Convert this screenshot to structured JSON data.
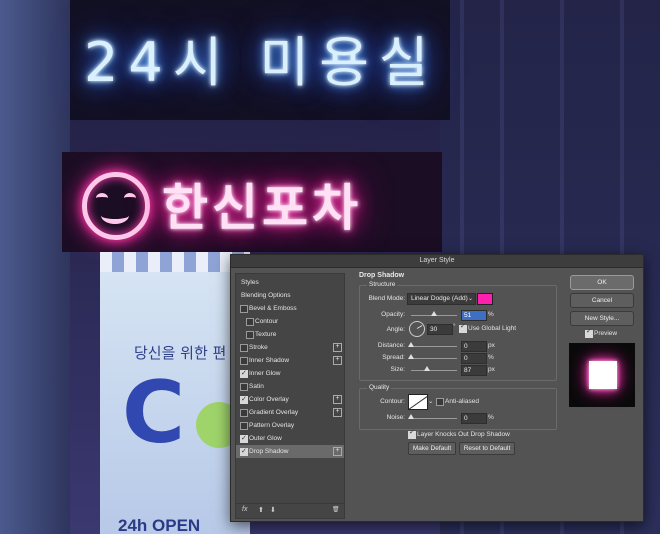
{
  "background": {
    "neon_blue_text": "24시 미용실",
    "neon_pink_text": "한신포차",
    "banner_text": "당신을 위한 편",
    "banner_letter": "C",
    "banner_hours": "24h OPEN",
    "colors": {
      "neon_blue": "#3a7bff",
      "neon_pink": "#ff1f9c"
    }
  },
  "dialog": {
    "title": "Layer Style",
    "styles_list": {
      "header": "Styles",
      "blending_options": "Blending Options",
      "items": [
        {
          "label": "Bevel & Emboss",
          "checked": false,
          "indent": false,
          "plus": false
        },
        {
          "label": "Contour",
          "checked": false,
          "indent": true,
          "plus": false
        },
        {
          "label": "Texture",
          "checked": false,
          "indent": true,
          "plus": false
        },
        {
          "label": "Stroke",
          "checked": false,
          "indent": false,
          "plus": true
        },
        {
          "label": "Inner Shadow",
          "checked": false,
          "indent": false,
          "plus": true
        },
        {
          "label": "Inner Glow",
          "checked": true,
          "indent": false,
          "plus": false
        },
        {
          "label": "Satin",
          "checked": false,
          "indent": false,
          "plus": false
        },
        {
          "label": "Color Overlay",
          "checked": true,
          "indent": false,
          "plus": true
        },
        {
          "label": "Gradient Overlay",
          "checked": false,
          "indent": false,
          "plus": true
        },
        {
          "label": "Pattern Overlay",
          "checked": false,
          "indent": false,
          "plus": false
        },
        {
          "label": "Outer Glow",
          "checked": true,
          "indent": false,
          "plus": false
        },
        {
          "label": "Drop Shadow",
          "checked": true,
          "indent": false,
          "plus": true,
          "selected": true
        }
      ],
      "footer": {
        "fx": "fx",
        "up": "⬆",
        "down": "⬇",
        "trash": "🗑"
      }
    },
    "drop_shadow": {
      "section_title": "Drop Shadow",
      "structure_title": "Structure",
      "blend_mode_label": "Blend Mode:",
      "blend_mode_value": "Linear Dodge (Add)",
      "blend_color": "#ff1fae",
      "opacity_label": "Opacity:",
      "opacity_value": "51",
      "opacity_unit": "%",
      "angle_label": "Angle:",
      "angle_value": "30",
      "angle_unit": "°",
      "use_global_light_label": "Use Global Light",
      "use_global_light": true,
      "distance_label": "Distance:",
      "distance_value": "0",
      "distance_unit": "px",
      "spread_label": "Spread:",
      "spread_value": "0",
      "spread_unit": "%",
      "size_label": "Size:",
      "size_value": "87",
      "size_unit": "px",
      "quality_title": "Quality",
      "contour_label": "Contour:",
      "anti_aliased_label": "Anti-aliased",
      "anti_aliased": false,
      "noise_label": "Noise:",
      "noise_value": "0",
      "noise_unit": "%",
      "knockout_label": "Layer Knocks Out Drop Shadow",
      "knockout": true,
      "make_default": "Make Default",
      "reset_default": "Reset to Default"
    },
    "buttons": {
      "ok": "OK",
      "cancel": "Cancel",
      "new_style": "New Style...",
      "preview_label": "Preview",
      "preview_checked": true
    }
  }
}
